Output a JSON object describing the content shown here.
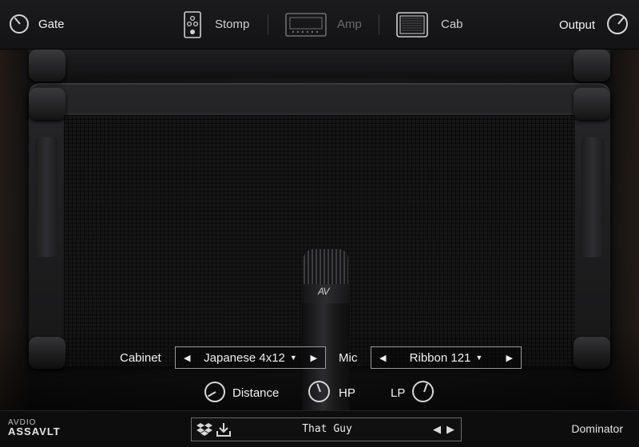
{
  "header": {
    "gate_label": "Gate",
    "output_label": "Output",
    "tabs": [
      {
        "label": "Stomp",
        "icon": "stomp-pedal-icon",
        "active": true
      },
      {
        "label": "Amp",
        "icon": "amp-head-icon",
        "active": false
      },
      {
        "label": "Cab",
        "icon": "cabinet-icon",
        "active": true
      }
    ]
  },
  "cab_panel": {
    "cabinet_label": "Cabinet",
    "cabinet_value": "Japanese 4x12",
    "mic_label": "Mic",
    "mic_value": "Ribbon 121",
    "distance_label": "Distance",
    "hp_label": "HP",
    "lp_label": "LP",
    "mic_logo": "AV"
  },
  "footer": {
    "logo_line1": "AVDIO",
    "logo_line2": "ASSAVLT",
    "preset_name": "That Guy",
    "product_name": "Dominator"
  },
  "colors": {
    "text": "#f2f2f2",
    "inactive_tab": "#6a6a6a",
    "panel_bg": "#131315"
  }
}
